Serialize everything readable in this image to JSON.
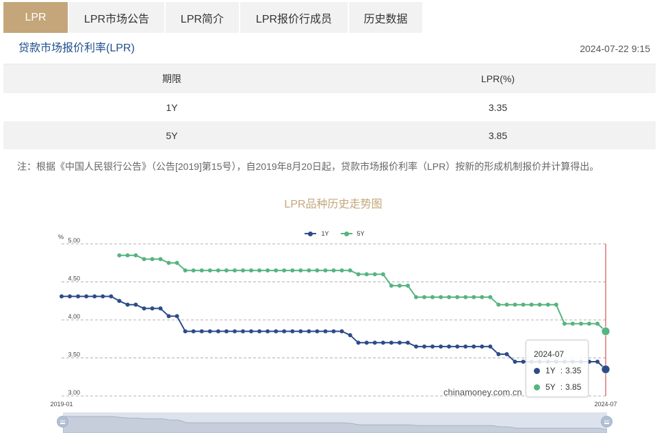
{
  "tabs": [
    {
      "label": "LPR",
      "active": true
    },
    {
      "label": "LPR市场公告",
      "active": false
    },
    {
      "label": "LPR简介",
      "active": false
    },
    {
      "label": "LPR报价行成员",
      "active": false
    },
    {
      "label": "历史数据",
      "active": false
    }
  ],
  "header": {
    "title": "贷款市场报价利率(LPR)",
    "timestamp": "2024-07-22 9:15"
  },
  "table": {
    "headers": [
      "期限",
      "LPR(%)"
    ],
    "rows": [
      [
        "1Y",
        "3.35"
      ],
      [
        "5Y",
        "3.85"
      ]
    ]
  },
  "note": "注：根据《中国人民银行公告》（公告[2019]第15号），自2019年8月20日起，贷款市场报价利率（LPR）按新的形成机制报价并计算得出。",
  "colors": {
    "accent": "#c4a67a",
    "section_title": "#1f4d8c",
    "pointer": "#c8322f"
  },
  "chart_data": {
    "type": "line",
    "title": "LPR品种历史走势图",
    "ylabel": "%",
    "ylim": [
      3.0,
      5.0
    ],
    "yticks": [
      "3.00",
      "3.50",
      "4.00",
      "4.50",
      "5.00"
    ],
    "xtick_labels": [
      "2019-01",
      "2024-07"
    ],
    "grid": true,
    "legend": "top-center",
    "x": [
      "2019-01",
      "2019-02",
      "2019-03",
      "2019-04",
      "2019-05",
      "2019-06",
      "2019-07",
      "2019-08",
      "2019-09",
      "2019-10",
      "2019-11",
      "2019-12",
      "2020-01",
      "2020-02",
      "2020-03",
      "2020-04",
      "2020-05",
      "2020-06",
      "2020-07",
      "2020-08",
      "2020-09",
      "2020-10",
      "2020-11",
      "2020-12",
      "2021-01",
      "2021-02",
      "2021-03",
      "2021-04",
      "2021-05",
      "2021-06",
      "2021-07",
      "2021-08",
      "2021-09",
      "2021-10",
      "2021-11",
      "2021-12",
      "2022-01",
      "2022-02",
      "2022-03",
      "2022-04",
      "2022-05",
      "2022-06",
      "2022-07",
      "2022-08",
      "2022-09",
      "2022-10",
      "2022-11",
      "2022-12",
      "2023-01",
      "2023-02",
      "2023-03",
      "2023-04",
      "2023-05",
      "2023-06",
      "2023-07",
      "2023-08",
      "2023-09",
      "2023-10",
      "2023-11",
      "2023-12",
      "2024-01",
      "2024-02",
      "2024-03",
      "2024-04",
      "2024-05",
      "2024-06",
      "2024-07"
    ],
    "series": [
      {
        "name": "1Y",
        "color": "#2c4c8a",
        "values": [
          4.31,
          4.31,
          4.31,
          4.31,
          4.31,
          4.31,
          4.31,
          4.25,
          4.2,
          4.2,
          4.15,
          4.15,
          4.15,
          4.05,
          4.05,
          3.85,
          3.85,
          3.85,
          3.85,
          3.85,
          3.85,
          3.85,
          3.85,
          3.85,
          3.85,
          3.85,
          3.85,
          3.85,
          3.85,
          3.85,
          3.85,
          3.85,
          3.85,
          3.85,
          3.85,
          3.8,
          3.7,
          3.7,
          3.7,
          3.7,
          3.7,
          3.7,
          3.7,
          3.65,
          3.65,
          3.65,
          3.65,
          3.65,
          3.65,
          3.65,
          3.65,
          3.65,
          3.65,
          3.55,
          3.55,
          3.45,
          3.45,
          3.45,
          3.45,
          3.45,
          3.45,
          3.45,
          3.45,
          3.45,
          3.45,
          3.45,
          3.35
        ]
      },
      {
        "name": "5Y",
        "color": "#56b47f",
        "values": [
          null,
          null,
          null,
          null,
          null,
          null,
          null,
          4.85,
          4.85,
          4.85,
          4.8,
          4.8,
          4.8,
          4.75,
          4.75,
          4.65,
          4.65,
          4.65,
          4.65,
          4.65,
          4.65,
          4.65,
          4.65,
          4.65,
          4.65,
          4.65,
          4.65,
          4.65,
          4.65,
          4.65,
          4.65,
          4.65,
          4.65,
          4.65,
          4.65,
          4.65,
          4.6,
          4.6,
          4.6,
          4.6,
          4.45,
          4.45,
          4.45,
          4.3,
          4.3,
          4.3,
          4.3,
          4.3,
          4.3,
          4.3,
          4.3,
          4.3,
          4.3,
          4.2,
          4.2,
          4.2,
          4.2,
          4.2,
          4.2,
          4.2,
          4.2,
          3.95,
          3.95,
          3.95,
          3.95,
          3.95,
          3.85
        ]
      }
    ],
    "tooltip": {
      "x": "2024-07",
      "separator": ":",
      "rows": [
        {
          "name": "1Y",
          "value": "3.35"
        },
        {
          "name": "5Y",
          "value": "3.85"
        }
      ]
    },
    "watermark": "chinamoney.com.cn"
  }
}
